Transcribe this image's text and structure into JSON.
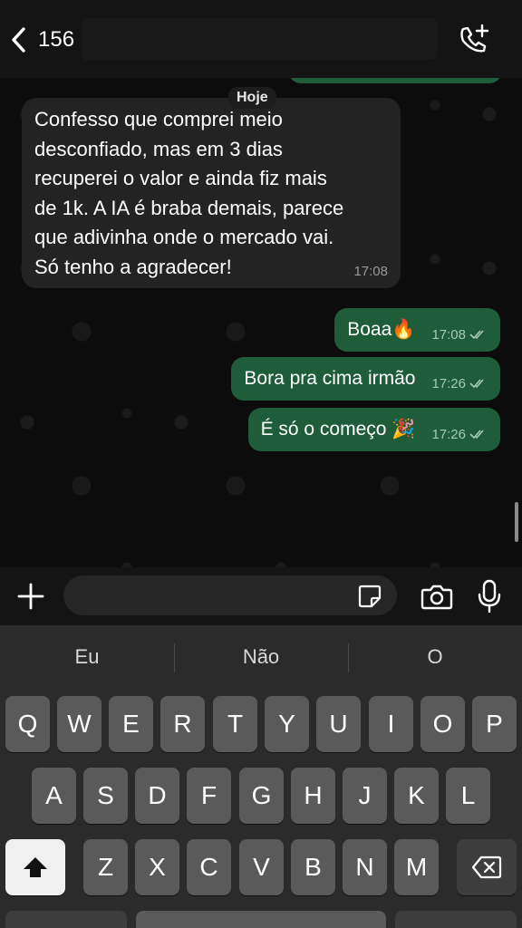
{
  "header": {
    "back_count": "156"
  },
  "chat": {
    "date_label": "Hoje",
    "incoming": {
      "text": "Confesso que comprei meio\ndesconfiado, mas em 3 dias\nrecuperei o valor e ainda fiz mais\nde 1k. A IA é braba demais, parece\nque adivinha onde o mercado vai.\nSó tenho a agradecer!",
      "time": "17:08"
    },
    "outgoing": [
      {
        "text": "Boaa🔥",
        "time": "17:08"
      },
      {
        "text": "Bora pra cima irmão",
        "time": "17:26"
      },
      {
        "text": "É só o começo 🎉",
        "time": "17:26"
      }
    ]
  },
  "composer": {
    "placeholder": ""
  },
  "keyboard": {
    "suggestions": [
      "Eu",
      "Não",
      "O"
    ],
    "row1": [
      "Q",
      "W",
      "E",
      "R",
      "T",
      "Y",
      "U",
      "I",
      "O",
      "P"
    ],
    "row2": [
      "A",
      "S",
      "D",
      "F",
      "G",
      "H",
      "J",
      "K",
      "L"
    ],
    "row3": [
      "Z",
      "X",
      "C",
      "V",
      "B",
      "N",
      "M"
    ]
  },
  "colors": {
    "outgoing_bubble": "#1f5c3a",
    "incoming_bubble": "#232323",
    "accent_ticks": "#a8c9b3"
  }
}
